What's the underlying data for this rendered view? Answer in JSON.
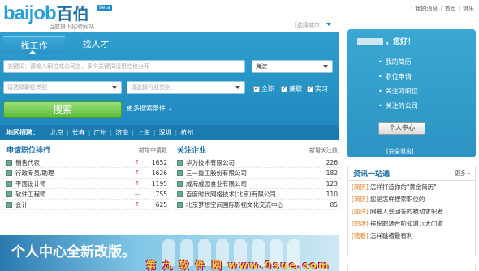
{
  "header": {
    "logo_en": "baijob",
    "logo_cn": "百伯",
    "beta": "beta",
    "slogan": "百度旗下招聘网站",
    "city_select": "[选择城市]",
    "links": [
      "我的消息",
      "首页",
      "退出"
    ]
  },
  "search": {
    "tabs": [
      "找工作",
      "找人才"
    ],
    "keyword_placeholder": "关键词：请输入职位或公司名，多个关键词请用空格分开",
    "location": "海淀",
    "job_category_placeholder": "请选择职位类别",
    "industry_placeholder": "请选择行业类别",
    "checks": [
      {
        "label": "全职",
        "checked": true
      },
      {
        "label": "兼职",
        "checked": true
      },
      {
        "label": "实习",
        "checked": true
      }
    ],
    "search_button": "搜索",
    "more_conditions": "更多搜索条件",
    "region_label": "地区招聘：",
    "cities": [
      "北京",
      "长春",
      "广州",
      "济南",
      "上海",
      "深圳",
      "杭州"
    ]
  },
  "jobs_ranking": {
    "title": "申请职位排行",
    "sub": "新增申请数",
    "rows": [
      {
        "name": "销售代表",
        "trend": "up",
        "count": "1652"
      },
      {
        "name": "行政专员/助理",
        "trend": "up",
        "count": "1626"
      },
      {
        "name": "平面设计师",
        "trend": "up",
        "count": "1195"
      },
      {
        "name": "软件工程师",
        "trend": "down",
        "count": "755"
      },
      {
        "name": "会计",
        "trend": "up",
        "count": "625"
      }
    ]
  },
  "companies": {
    "title": "关注企业",
    "sub": "新增关注数",
    "rows": [
      {
        "name": "华为技术有限公司",
        "count": "226"
      },
      {
        "name": "三一重工股份有限公司",
        "count": "182"
      },
      {
        "name": "威海威园食业有限公司",
        "count": "123"
      },
      {
        "name": "百度时代网络技术(北京)有限公司",
        "count": "110"
      },
      {
        "name": "北京梦想空间国际影视文化交流中心",
        "count": "85"
      }
    ]
  },
  "banner": {
    "text": "个人中心全新改版。",
    "watermark": "第 九 软 件 网   www.9sue.com"
  },
  "user": {
    "greeting_suffix": "，您好！",
    "links": [
      "我的简历",
      "职位申请",
      "关注的职位",
      "关注的公司"
    ],
    "center_button": "个人中心",
    "logout": "[安全退出]"
  },
  "info": {
    "title": "资讯一站通",
    "more": "更多",
    "items": [
      {
        "tag": "[简历]",
        "text": "怎样打造你的\"黄金简历\""
      },
      {
        "tag": "[简历]",
        "text": "您是怎样搜索职位的"
      },
      {
        "tag": "[面试]",
        "text": "刚融入会回答的被动求职者"
      },
      {
        "tag": "[职场]",
        "text": "摆脱职场台阶知道九大门道"
      },
      {
        "tag": "[我看]",
        "text": "怎样跳槽最有利"
      }
    ]
  }
}
